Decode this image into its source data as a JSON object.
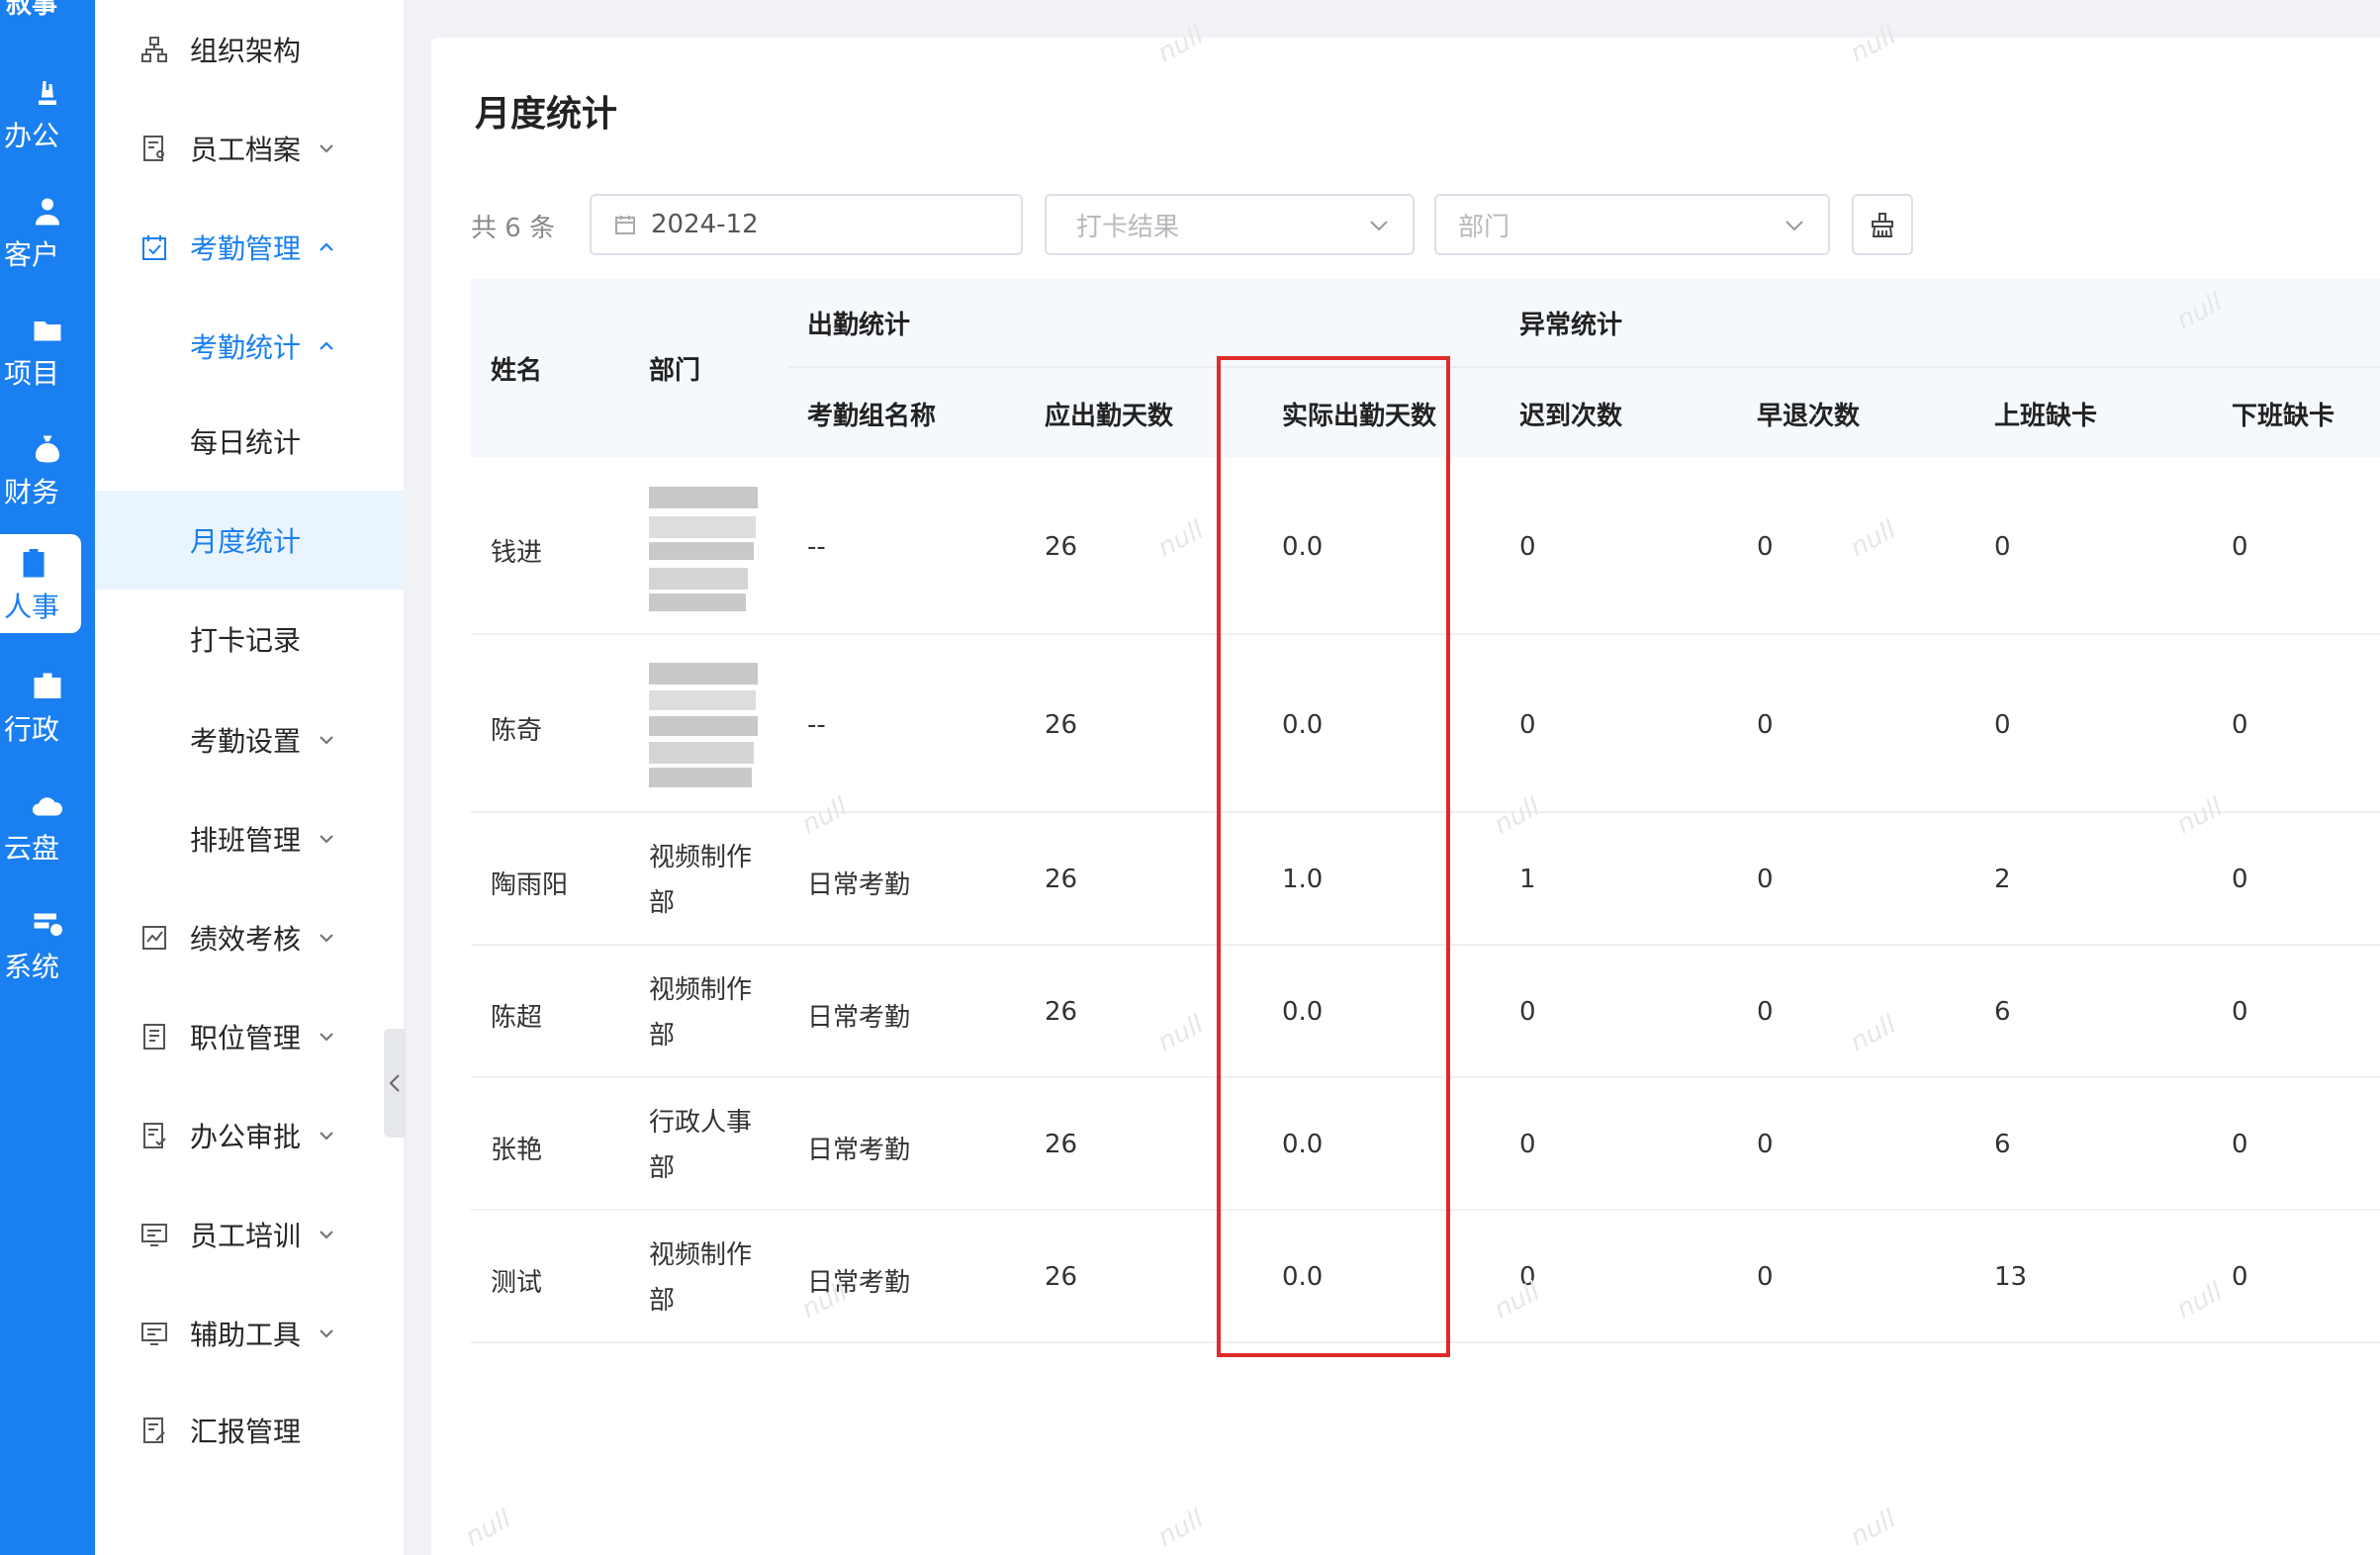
{
  "rail": {
    "top_text": "叔事",
    "items": [
      {
        "label": "办公",
        "icon": "office-icon"
      },
      {
        "label": "客户",
        "icon": "customer-icon"
      },
      {
        "label": "项目",
        "icon": "project-icon"
      },
      {
        "label": "财务",
        "icon": "finance-icon"
      },
      {
        "label": "人事",
        "icon": "hr-icon",
        "active": true
      },
      {
        "label": "行政",
        "icon": "admin-icon"
      },
      {
        "label": "云盘",
        "icon": "cloud-drive-icon"
      },
      {
        "label": "系统",
        "icon": "system-icon"
      }
    ]
  },
  "menu": {
    "items": [
      {
        "label": "组织架构"
      },
      {
        "label": "员工档案"
      },
      {
        "label": "考勤管理"
      },
      {
        "label": "考勤统计"
      },
      {
        "label": "每日统计"
      },
      {
        "label": "月度统计"
      },
      {
        "label": "打卡记录"
      },
      {
        "label": "考勤设置"
      },
      {
        "label": "排班管理"
      },
      {
        "label": "绩效考核"
      },
      {
        "label": "职位管理"
      },
      {
        "label": "办公审批"
      },
      {
        "label": "员工培训"
      },
      {
        "label": "辅助工具"
      },
      {
        "label": "汇报管理"
      }
    ]
  },
  "page": {
    "title": "月度统计",
    "count": "共 6 条"
  },
  "filters": {
    "month": "2024-12",
    "punch_result_placeholder": "打卡结果",
    "department_placeholder": "部门"
  },
  "table": {
    "headers": {
      "name": "姓名",
      "department": "部门",
      "attendance_group": "出勤统计",
      "anomaly_group": "异常统计",
      "group_name": "考勤组名称",
      "required_days": "应出勤天数",
      "actual_days": "实际出勤天数",
      "late": "迟到次数",
      "early_leave": "早退次数",
      "missing_in": "上班缺卡",
      "missing_out": "下班缺卡"
    },
    "rows": [
      {
        "name": "钱进",
        "dept": "",
        "group": "--",
        "required": "26",
        "actual": "0.0",
        "late": "0",
        "early": "0",
        "miss_in": "0",
        "miss_out": "0"
      },
      {
        "name": "陈奇",
        "dept": "",
        "group": "--",
        "required": "26",
        "actual": "0.0",
        "late": "0",
        "early": "0",
        "miss_in": "0",
        "miss_out": "0"
      },
      {
        "name": "陶雨阳",
        "dept": "视频制作部",
        "dept_l1": "视频制作",
        "dept_l2": "部",
        "group": "日常考勤",
        "required": "26",
        "actual": "1.0",
        "late": "1",
        "early": "0",
        "miss_in": "2",
        "miss_out": "0"
      },
      {
        "name": "陈超",
        "dept": "视频制作部",
        "dept_l1": "视频制作",
        "dept_l2": "部",
        "group": "日常考勤",
        "required": "26",
        "actual": "0.0",
        "late": "0",
        "early": "0",
        "miss_in": "6",
        "miss_out": "0"
      },
      {
        "name": "张艳",
        "dept": "行政人事部",
        "dept_l1": "行政人事",
        "dept_l2": "部",
        "group": "日常考勤",
        "required": "26",
        "actual": "0.0",
        "late": "0",
        "early": "0",
        "miss_in": "6",
        "miss_out": "0"
      },
      {
        "name": "测试",
        "dept": "视频制作部",
        "dept_l1": "视频制作",
        "dept_l2": "部",
        "group": "日常考勤",
        "required": "26",
        "actual": "0.0",
        "late": "0",
        "early": "0",
        "miss_in": "13",
        "miss_out": "0"
      }
    ]
  },
  "watermark": "null",
  "colors": {
    "primary": "#1a7ff0",
    "highlight_box": "#e12a2a"
  }
}
